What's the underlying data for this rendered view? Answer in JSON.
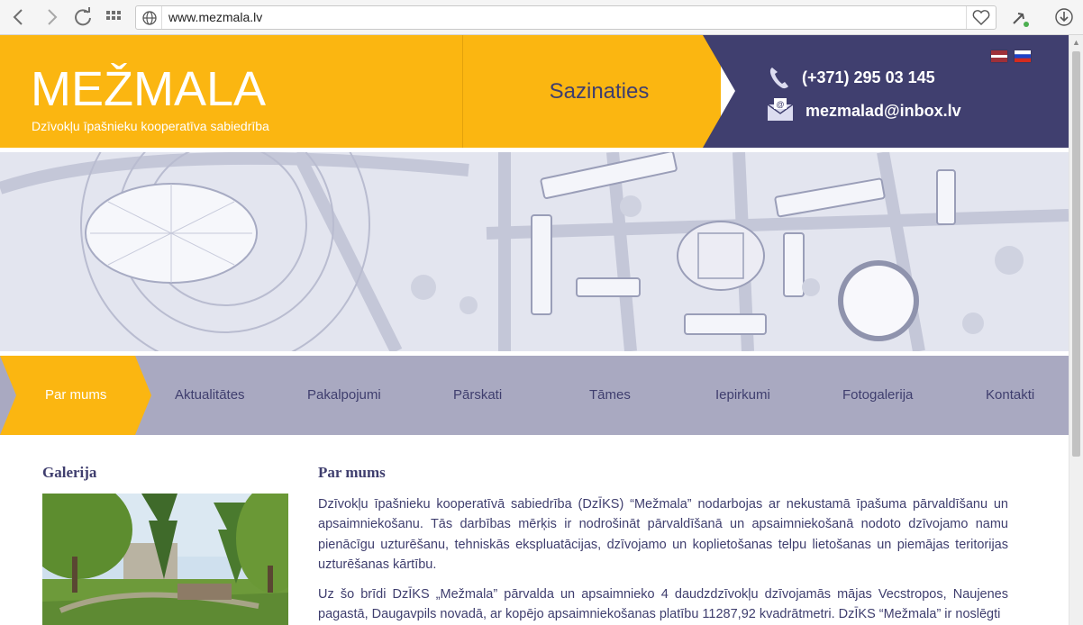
{
  "browser": {
    "url": "www.mezmala.lv",
    "icons": [
      "back-icon",
      "forward-icon",
      "reload-icon",
      "apps-grid-icon",
      "globe-icon",
      "heart-icon",
      "extension-icon",
      "download-icon"
    ]
  },
  "header": {
    "logo": "MEŽMALA",
    "tagline": "Dzīvokļu īpašnieku kooperatīva sabiedrība",
    "contact_link": "Sazinaties",
    "phone": "(+371) 295 03 145",
    "email": "mezmalad@inbox.lv",
    "languages": [
      "lv",
      "ru"
    ]
  },
  "nav": {
    "items": [
      "Par mums",
      "Aktualitātes",
      "Pakalpojumi",
      "Pārskati",
      "Tāmes",
      "Iepirkumi",
      "Fotogalerija",
      "Kontakti"
    ],
    "active": "Par mums"
  },
  "sidebar": {
    "title": "Galerija"
  },
  "main": {
    "title": "Par mums",
    "paragraphs": [
      "Dzīvokļu īpašnieku kooperatīvā sabiedrība (DzĪKS) “Mežmala” nodarbojas ar nekustamā īpašuma pārvaldīšanu un apsaimniekošanu. Tās darbības mērķis ir nodrošināt pārvaldīšanā un apsaimniekošanā nodoto dzīvojamo namu pienācīgu uzturēšanu, tehniskās ekspluatācijas, dzīvojamo un koplietošanas telpu lietošanas un piemājas teritorijas uzturēšanas kārtību.",
      "Uz šo brīdi DzĪKS „Mežmala” pārvalda un apsaimnieko 4 daudzdzīvokļu dzīvojamās mājas Vecstropos, Naujenes pagastā, Daugavpils novadā, ar kopējo apsaimniekošanas platību 11287,92 kvadrātmetri. DzĪKS “Mežmala” ir noslēgti"
    ]
  },
  "colors": {
    "accent_yellow": "#fbb611",
    "brand_navy": "#403f6f",
    "nav_grey": "#a9a9c1",
    "text": "#3f3e6e"
  }
}
